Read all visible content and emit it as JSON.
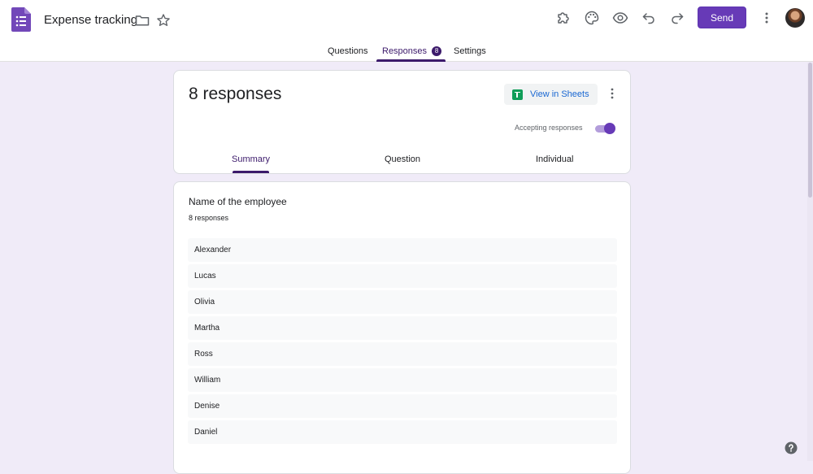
{
  "header": {
    "title": "Expense tracking",
    "send_label": "Send"
  },
  "tabs": [
    {
      "label": "Questions"
    },
    {
      "label": "Responses",
      "badge": "8"
    },
    {
      "label": "Settings"
    }
  ],
  "summary": {
    "title": "8 responses",
    "sheets_label": "View in Sheets",
    "accepting_label": "Accepting responses",
    "accepting_on": true,
    "subtabs": [
      {
        "label": "Summary"
      },
      {
        "label": "Question"
      },
      {
        "label": "Individual"
      }
    ]
  },
  "question": {
    "title": "Name of the employee",
    "count": "8 responses",
    "answers": [
      "Alexander",
      "Lucas",
      "Olivia",
      "Martha",
      "Ross",
      "William",
      "Denise",
      "Daniel"
    ]
  },
  "colors": {
    "accent": "#673ab7",
    "background": "#f0ebf8",
    "link": "#1967d2"
  }
}
